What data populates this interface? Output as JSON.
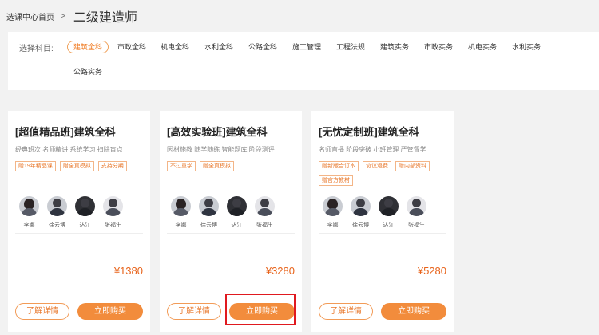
{
  "breadcrumb": {
    "home": "选课中心首页",
    "separator": ">",
    "title": "二级建造师"
  },
  "filter": {
    "label": "选择科目:",
    "subjects": [
      "建筑全科",
      "市政全科",
      "机电全科",
      "水利全科",
      "公路全科",
      "施工管理",
      "工程法规",
      "建筑实务",
      "市政实务",
      "机电实务",
      "水利实务",
      "公路实务"
    ],
    "active_index": 0
  },
  "cards": [
    {
      "title": "[超值精品班]建筑全科",
      "desc": "经典班次 名师精讲 系统学习 扫除盲点",
      "tags": [
        "赠19年精品课",
        "赠全真模拟",
        "支持分期"
      ],
      "teachers": [
        "李娜",
        "徐云博",
        "达江",
        "张福生"
      ],
      "price": "¥1380",
      "detail_label": "了解详情",
      "buy_label": "立即购买"
    },
    {
      "title": "[高效实验班]建筑全科",
      "desc": "因材施教 随学随练 智能题库 阶段测评",
      "tags": [
        "不过重学",
        "赠全真模拟"
      ],
      "teachers": [
        "李娜",
        "徐云博",
        "达江",
        "张福生"
      ],
      "price": "¥3280",
      "detail_label": "了解详情",
      "buy_label": "立即购买"
    },
    {
      "title": "[无忧定制班]建筑全科",
      "desc": "名师直播 阶段突破 小班管理 严管督学",
      "tags": [
        "赠新版合订本",
        "协议退费",
        "赠内部资料",
        "赠官方教材"
      ],
      "teachers": [
        "李娜",
        "徐云博",
        "达江",
        "张福生"
      ],
      "price": "¥5280",
      "detail_label": "了解详情",
      "buy_label": "立即购买"
    }
  ]
}
